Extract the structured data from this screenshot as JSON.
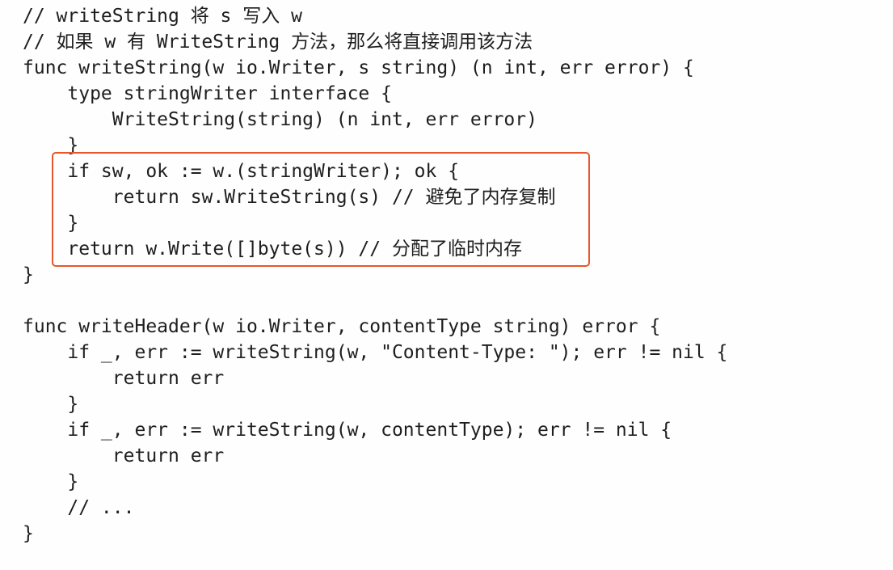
{
  "code": {
    "lines": [
      "// writeString 将 s 写入 w",
      "// 如果 w 有 WriteString 方法，那么将直接调用该方法",
      "func writeString(w io.Writer, s string) (n int, err error) {",
      "    type stringWriter interface {",
      "        WriteString(string) (n int, err error)",
      "    }",
      "    if sw, ok := w.(stringWriter); ok {",
      "        return sw.WriteString(s) // 避免了内存复制",
      "    }",
      "    return w.Write([]byte(s)) // 分配了临时内存",
      "}",
      "",
      "func writeHeader(w io.Writer, contentType string) error {",
      "    if _, err := writeString(w, \"Content-Type: \"); err != nil {",
      "        return err",
      "    }",
      "    if _, err := writeString(w, contentType); err != nil {",
      "        return err",
      "    }",
      "    // ...",
      "}"
    ]
  },
  "highlight": {
    "color": "#e8562a",
    "first_line": 6,
    "last_line": 9
  }
}
